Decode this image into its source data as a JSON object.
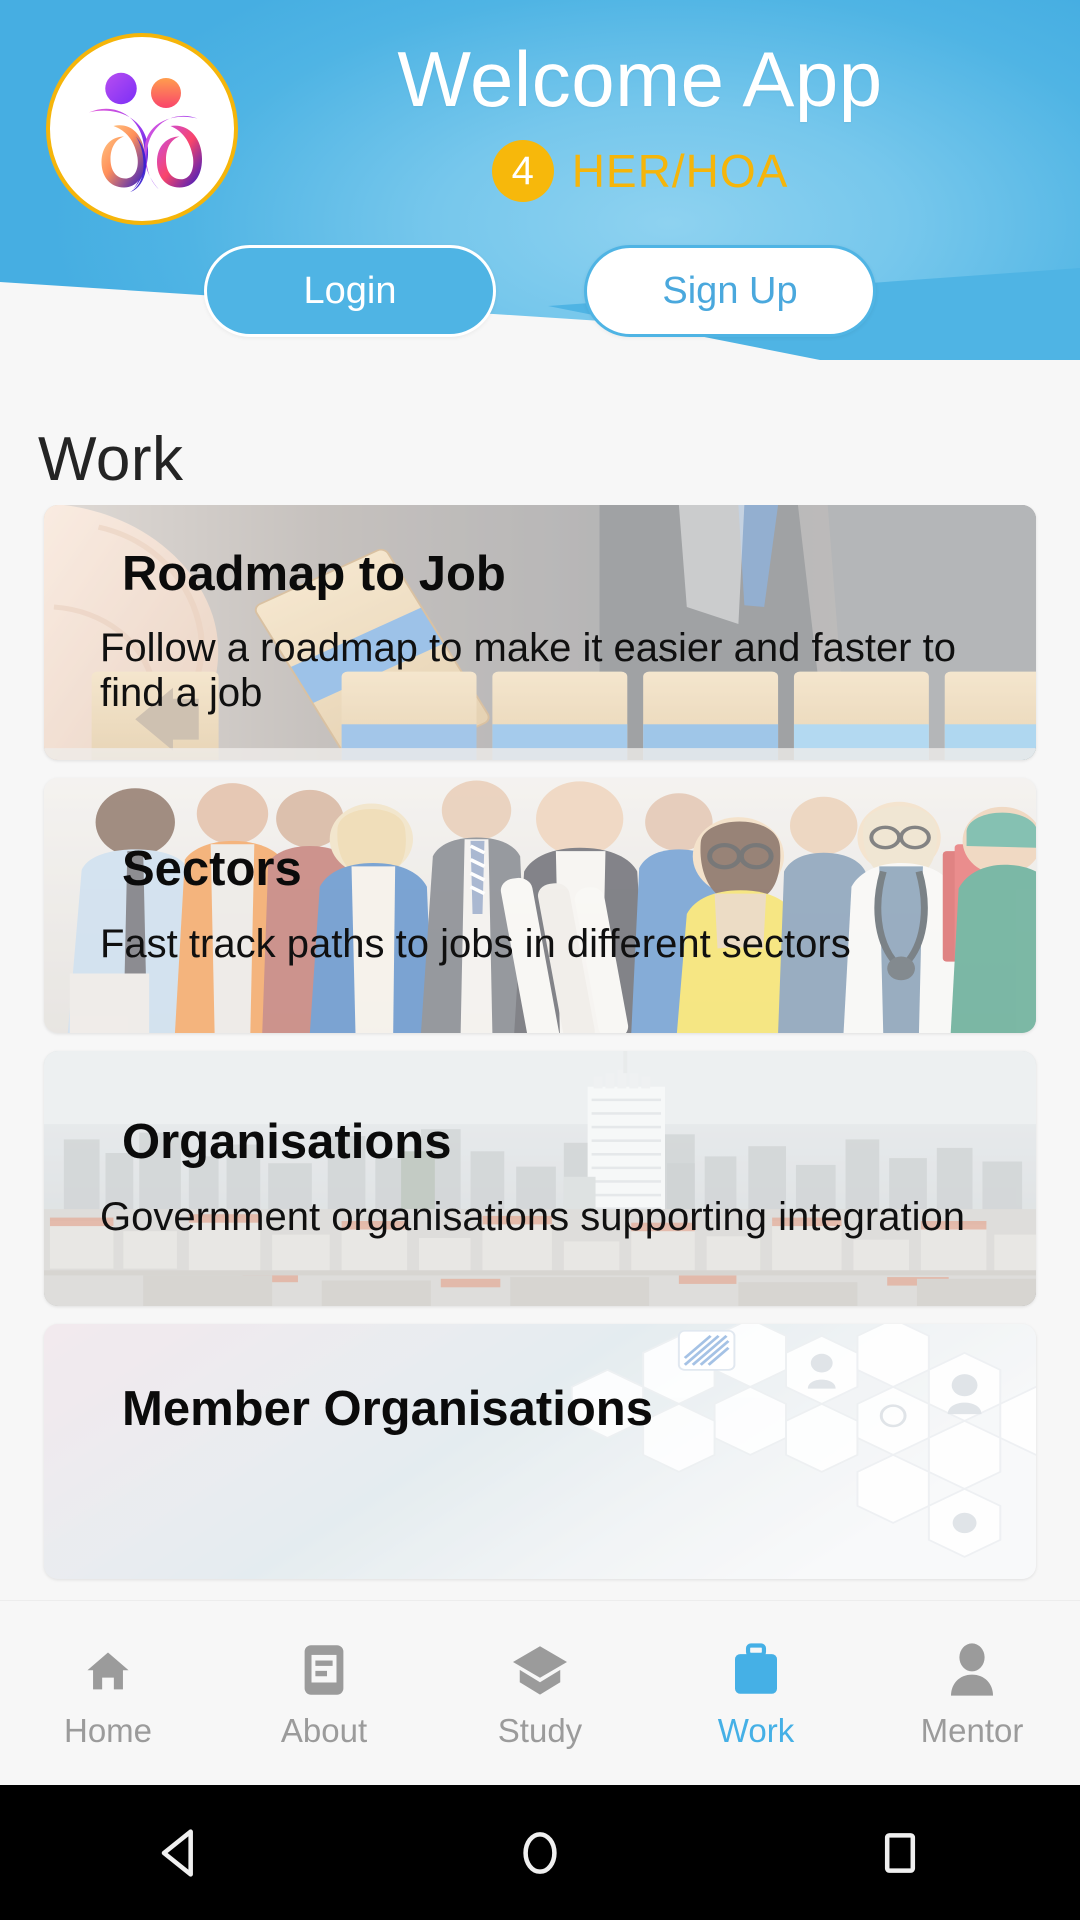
{
  "header": {
    "app_title": "Welcome App",
    "badge_count": "4",
    "sub_label": "HER/HOA",
    "logo_name": "welcome-app-logo",
    "bg_color": "#4fb4e4",
    "accent_color": "#f5b50a"
  },
  "auth": {
    "login_label": "Login",
    "signup_label": "Sign Up"
  },
  "page": {
    "title": "Work"
  },
  "cards": [
    {
      "title": "Roadmap to Job",
      "desc": "Follow a roadmap to make it easier and faster to find a job",
      "art": "wooden-blocks-businessman"
    },
    {
      "title": "Sectors",
      "desc": "Fast track paths to jobs in different sectors",
      "art": "diverse-professionals-group"
    },
    {
      "title": "Organisations",
      "desc": "Government organisations supporting integration",
      "art": "aerial-cityscape-haze"
    },
    {
      "title": "Member Organisations",
      "desc": "",
      "art": "hexagon-network-pattern"
    }
  ],
  "tabs": [
    {
      "label": "Home",
      "icon": "home-icon",
      "active": false
    },
    {
      "label": "About",
      "icon": "article-icon",
      "active": false
    },
    {
      "label": "Study",
      "icon": "graduation-cap-icon",
      "active": false
    },
    {
      "label": "Work",
      "icon": "briefcase-icon",
      "active": true
    },
    {
      "label": "Mentor",
      "icon": "person-icon",
      "active": false
    }
  ],
  "tab_active_color": "#45b0e6",
  "tab_inactive_color": "#9b9b9b",
  "android_nav": [
    {
      "name": "back-button",
      "icon": "triangle-left-icon"
    },
    {
      "name": "home-button",
      "icon": "circle-icon"
    },
    {
      "name": "recents-button",
      "icon": "square-icon"
    }
  ]
}
